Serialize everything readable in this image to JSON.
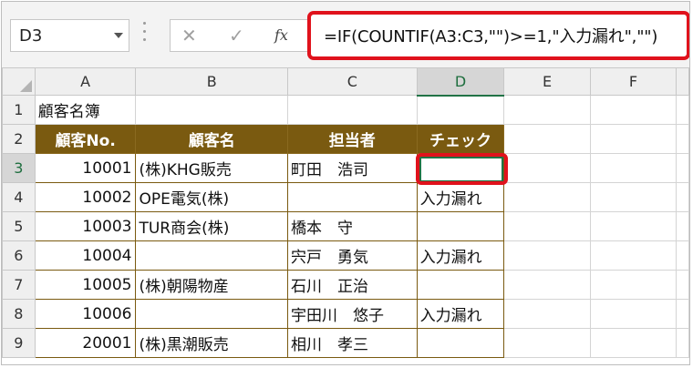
{
  "formula_bar": {
    "name_box": "D3",
    "cancel_glyph": "✕",
    "enter_glyph": "✓",
    "fx_glyph": "fx",
    "formula": "=IF(COUNTIF(A3:C3,\"\")>=1,\"入力漏れ\",\"\")"
  },
  "columns": [
    "A",
    "B",
    "C",
    "D",
    "E",
    "F"
  ],
  "rows": [
    {
      "n": "1",
      "a": "顧客名簿",
      "b": "",
      "c": "",
      "d": ""
    },
    {
      "n": "2",
      "a": "顧客No.",
      "b": "顧客名",
      "c": "担当者",
      "d": "チェック"
    },
    {
      "n": "3",
      "a": "10001",
      "b": "(株)KHG販売",
      "c": "町田　浩司",
      "d": ""
    },
    {
      "n": "4",
      "a": "10002",
      "b": "OPE電気(株)",
      "c": "",
      "d": "入力漏れ"
    },
    {
      "n": "5",
      "a": "10003",
      "b": "TUR商会(株)",
      "c": "橋本　守",
      "d": ""
    },
    {
      "n": "6",
      "a": "10004",
      "b": "",
      "c": "宍戸　勇気",
      "d": "入力漏れ"
    },
    {
      "n": "7",
      "a": "10005",
      "b": "(株)朝陽物産",
      "c": "石川　正治",
      "d": ""
    },
    {
      "n": "8",
      "a": "10006",
      "b": "",
      "c": "宇田川　悠子",
      "d": "入力漏れ"
    },
    {
      "n": "9",
      "a": "20001",
      "b": "(株)黒潮販売",
      "c": "相川　孝三",
      "d": ""
    }
  ],
  "colors": {
    "header_fill": "#7a5a10",
    "highlight": "#e0121c",
    "selection": "#217346"
  }
}
